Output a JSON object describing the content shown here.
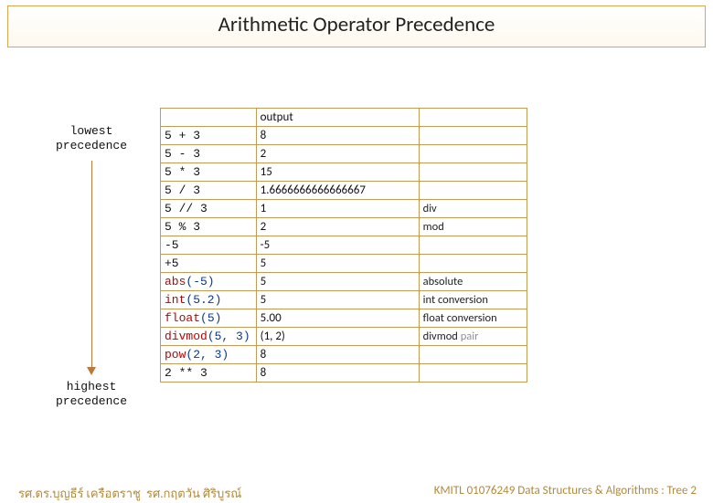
{
  "title": "Arithmetic Operator Precedence",
  "labels": {
    "lowest_line1": "lowest",
    "lowest_line2": "precedence",
    "highest_line1": "highest",
    "highest_line2": "precedence"
  },
  "table": {
    "header_expr": "",
    "header_output": "output",
    "header_desc": "",
    "rows": [
      {
        "expr": "5 + 3",
        "out": " 8",
        "desc": ""
      },
      {
        "expr": "5 - 3",
        "out": " 2",
        "desc": ""
      },
      {
        "expr": "5 * 3",
        "out": " 15",
        "desc": ""
      },
      {
        "expr": "5 / 3",
        "out": "1.6666666666666667",
        "desc": ""
      },
      {
        "expr": "5 // 3",
        "out": "1",
        "desc": "div"
      },
      {
        "expr": "5 % 3",
        "out": "2",
        "desc": "mod"
      },
      {
        "expr": "-5",
        "out": "-5",
        "desc": ""
      },
      {
        "expr": "+5",
        "out": "5",
        "desc": ""
      },
      {
        "expr_html": [
          [
            "abs",
            "red"
          ],
          [
            "(-5)",
            "blue"
          ]
        ],
        "out": "5",
        "desc": "absolute"
      },
      {
        "expr_html": [
          [
            "int",
            "red"
          ],
          [
            "(5.2)",
            "blue"
          ]
        ],
        "out": "5",
        "desc": "int conversion"
      },
      {
        "expr_html": [
          [
            "float",
            "red"
          ],
          [
            "(5)",
            "blue"
          ]
        ],
        "out": "5.00",
        "desc": "float conversion"
      },
      {
        "expr_html": [
          [
            "divmod",
            "red"
          ],
          [
            "(5, 3)",
            "blue"
          ]
        ],
        "out": "(1, 2)",
        "desc_html": [
          [
            "divmod ",
            "black"
          ],
          [
            "pair",
            "grey"
          ]
        ]
      },
      {
        "expr_html": [
          [
            "pow",
            "red"
          ],
          [
            "(2, 3)",
            "blue"
          ]
        ],
        "out": "8",
        "desc": ""
      },
      {
        "expr": "2 ** 3",
        "out": "8",
        "desc": ""
      }
    ]
  },
  "footer": {
    "left": "รศ.ดร.บุญธีร์     เครือตราชู",
    "mid": "รศ.กฤตวัน     ศิริบูรณ์",
    "right": "KMITL   01076249 Data Structures & Algorithms : Tree 2"
  }
}
